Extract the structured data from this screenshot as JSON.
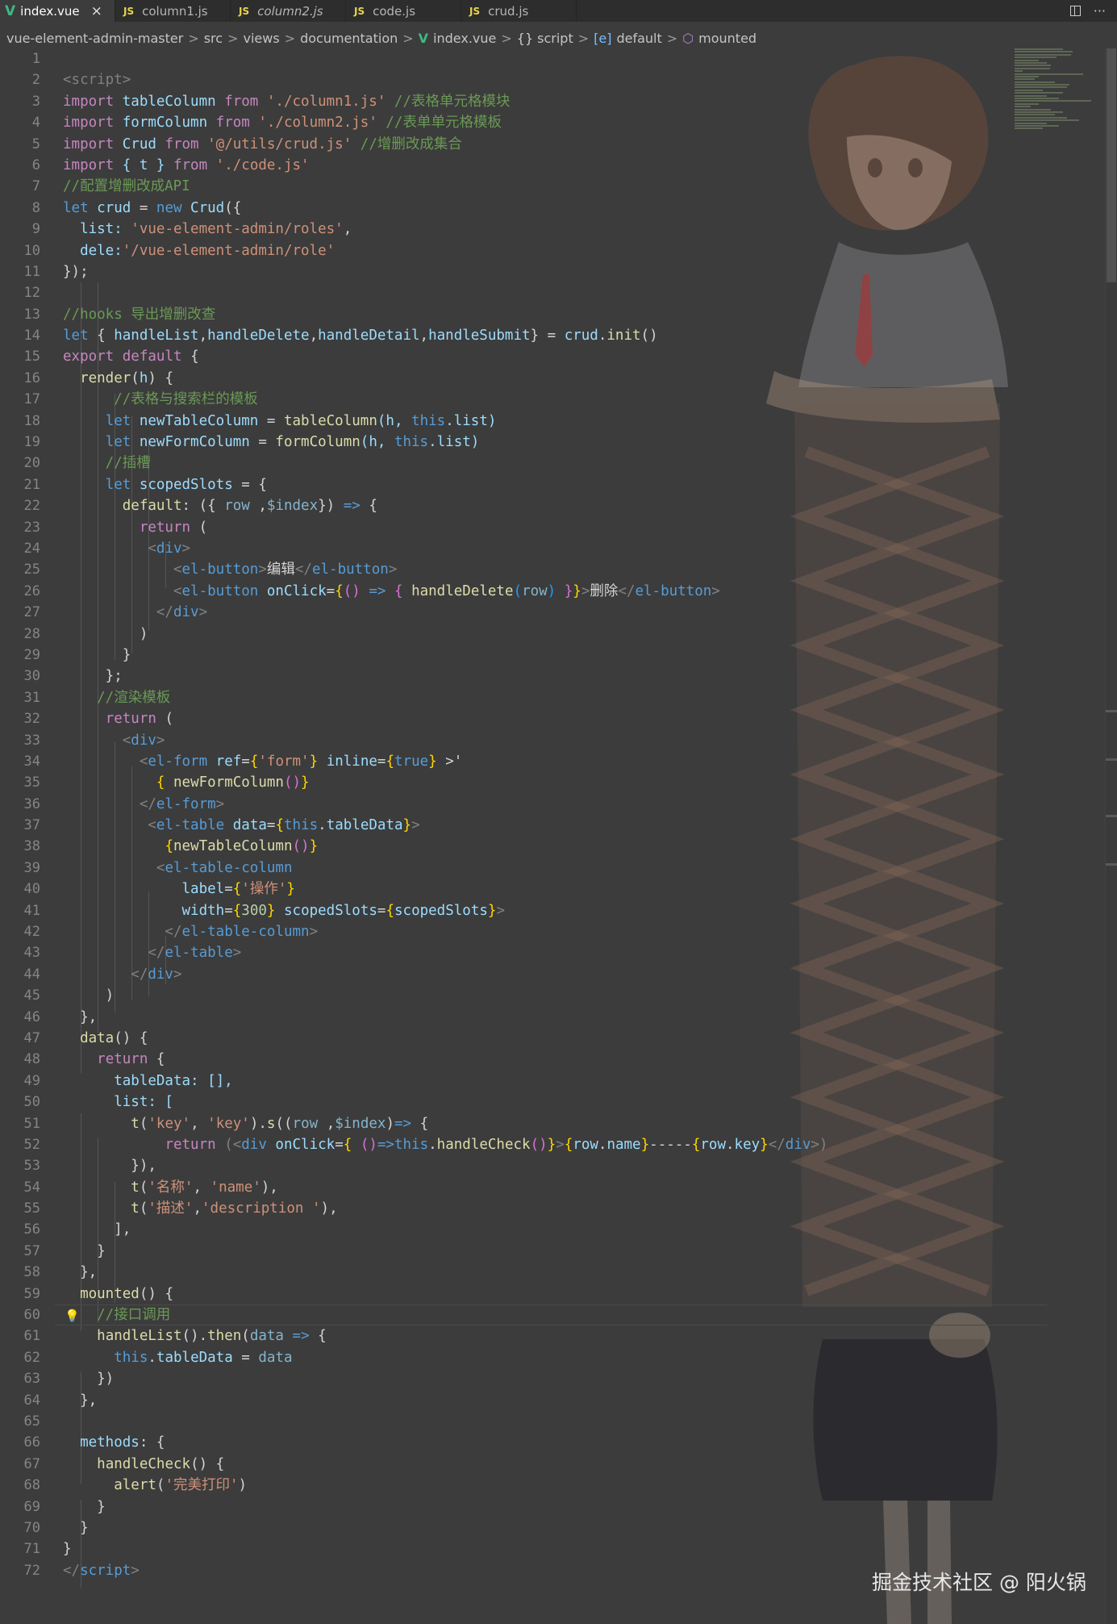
{
  "tabs": [
    {
      "label": "index.vue",
      "icon": "vue-icon",
      "active": true,
      "close": "×"
    },
    {
      "label": "column1.js",
      "icon": "js-icon",
      "icon_text": "JS"
    },
    {
      "label": "column2.js",
      "icon": "js-icon",
      "icon_text": "JS",
      "italic": true
    },
    {
      "label": "code.js",
      "icon": "js-icon",
      "icon_text": "JS"
    },
    {
      "label": "crud.js",
      "icon": "js-icon",
      "icon_text": "JS"
    }
  ],
  "tab_actions": {
    "more": "···"
  },
  "breadcrumb": {
    "items": [
      "vue-element-admin-master",
      "src",
      "views",
      "documentation"
    ],
    "file": "index.vue",
    "file_icon": "V",
    "braces": "{}",
    "script": "script",
    "symbol_icon": "[e]",
    "symbol": "default",
    "method_icon": "⬡",
    "method": "mounted",
    "separator": ">"
  },
  "editor": {
    "line_numbers": [
      "1",
      "2",
      "3",
      "4",
      "5",
      "6",
      "7",
      "8",
      "9",
      "10",
      "11",
      "12",
      "13",
      "14",
      "15",
      "16",
      "17",
      "18",
      "19",
      "20",
      "21",
      "22",
      "23",
      "24",
      "25",
      "26",
      "27",
      "28",
      "29",
      "30",
      "31",
      "32",
      "33",
      "34",
      "35",
      "36",
      "37",
      "38",
      "39",
      "40",
      "41",
      "42",
      "43",
      "44",
      "45",
      "46",
      "47",
      "48",
      "49",
      "50",
      "51",
      "52",
      "53",
      "54",
      "55",
      "56",
      "57",
      "58",
      "59",
      "60",
      "61",
      "62",
      "63",
      "64",
      "65",
      "66",
      "67",
      "68",
      "69",
      "70",
      "71",
      "72"
    ],
    "current_line": 60,
    "lightbulb_line": 60
  },
  "code": {
    "l2": [
      "<script>"
    ],
    "l3": [
      "import",
      " tableColumn ",
      "from",
      " './column1.js'",
      " //表格单元格模块"
    ],
    "l4": [
      "import",
      " formColumn ",
      "from",
      " './column2.js'",
      " //表单单元格模板"
    ],
    "l5": [
      "import",
      " Crud ",
      "from",
      " '@/utils/crud.js'",
      " //增删改成集合"
    ],
    "l6": [
      "import",
      " { t } ",
      "from",
      " './code.js'"
    ],
    "l7": [
      "//配置增删改成API"
    ],
    "l8": [
      "let",
      " crud",
      " = ",
      "new",
      " Crud",
      "({"
    ],
    "l9": [
      "  list: ",
      "'vue-element-admin/roles'",
      ","
    ],
    "l10": [
      "  dele:",
      "'/vue-element-admin/role'"
    ],
    "l11": [
      "});"
    ],
    "l13": [
      "//hooks 导出增删改查"
    ],
    "l14": [
      "let",
      " { ",
      "handleList",
      ",",
      "handleDelete",
      ",",
      "handleDetail",
      ",",
      "handleSubmit",
      "} = ",
      "crud",
      ".",
      "init",
      "()"
    ],
    "l15": [
      "export",
      " ",
      "default",
      " {"
    ],
    "l16": [
      "  ",
      "render",
      "(",
      "h",
      ") {"
    ],
    "l17": [
      "      //表格与搜索栏的模板"
    ],
    "l18": [
      "     ",
      "let",
      " ",
      "newTableColumn",
      " = ",
      "tableColumn",
      "(h, ",
      "this",
      ".list)"
    ],
    "l19": [
      "     ",
      "let",
      " ",
      "newFormColumn",
      " = ",
      "formColumn",
      "(h, ",
      "this",
      ".list)"
    ],
    "l20": [
      "     //插槽"
    ],
    "l21": [
      "     ",
      "let",
      " ",
      "scopedSlots",
      " = {"
    ],
    "l22": [
      "       ",
      "default",
      ": ({ ",
      "row",
      " ,",
      "$index",
      "}) ",
      "=>",
      " {"
    ],
    "l23": [
      "         ",
      "return",
      " ("
    ],
    "l24": [
      "          <",
      "div",
      ">"
    ],
    "l25": [
      "             <",
      "el-button",
      ">",
      "编辑",
      "</",
      "el-button",
      ">"
    ],
    "l26": [
      "             <",
      "el-button",
      " ",
      "onClick",
      "=",
      "{",
      "()",
      " => ",
      "{",
      " ",
      "handleDelete",
      "(",
      "row",
      ") ",
      "}",
      "}",
      ">",
      "删除",
      "</",
      "el-button",
      ">"
    ],
    "l27": [
      "           </",
      "div",
      ">"
    ],
    "l28": [
      "         )"
    ],
    "l29": [
      "       }"
    ],
    "l30": [
      "     };"
    ],
    "l31": [
      "    //渲染模板"
    ],
    "l32": [
      "     ",
      "return",
      " ("
    ],
    "l33": [
      "       <",
      "div",
      ">"
    ],
    "l34": [
      "         <",
      "el-form",
      " ",
      "ref",
      "=",
      "{",
      "'form'",
      "}",
      " ",
      "inline",
      "=",
      "{",
      "true",
      "}",
      " >'"
    ],
    "l35": [
      "           ",
      "{",
      " ",
      "newFormColumn",
      "()",
      "}"
    ],
    "l36": [
      "         </",
      "el-form",
      ">"
    ],
    "l37": [
      "          <",
      "el-table",
      " ",
      "data",
      "=",
      "{",
      "this",
      ".",
      "tableData",
      "}",
      ">"
    ],
    "l38": [
      "            ",
      "{",
      "newTableColumn",
      "()",
      "}"
    ],
    "l39": [
      "           <",
      "el-table-column"
    ],
    "l40": [
      "              ",
      "label",
      "=",
      "{",
      "'操作'",
      "}"
    ],
    "l41": [
      "              ",
      "width",
      "=",
      "{",
      "300",
      "}",
      " ",
      "scopedSlots",
      "=",
      "{",
      "scopedSlots",
      "}",
      ">"
    ],
    "l42": [
      "            </",
      "el-table-column",
      ">"
    ],
    "l43": [
      "          </",
      "el-table",
      ">"
    ],
    "l44": [
      "        </",
      "div",
      ">"
    ],
    "l45": [
      "     )"
    ],
    "l46": [
      "  },"
    ],
    "l47": [
      "  ",
      "data",
      "() {"
    ],
    "l48": [
      "    ",
      "return",
      " {"
    ],
    "l49": [
      "      tableData: [],"
    ],
    "l50": [
      "      list: ["
    ],
    "l51": [
      "        ",
      "t",
      "(",
      "'key'",
      ", ",
      "'key'",
      ").",
      "s",
      "((",
      "row",
      " ,",
      "$index",
      ")",
      "=>",
      " {"
    ],
    "l52": [
      "            ",
      "return",
      " (<",
      "div",
      " ",
      "onClick",
      "=",
      "{",
      " ()",
      "=>",
      "this",
      ".",
      "handleCheck",
      "()",
      "}",
      ">",
      "{",
      "row",
      ".",
      "name",
      "}",
      "-----",
      "{",
      "row",
      ".",
      "key",
      "}",
      "</",
      "div",
      ">)"
    ],
    "l53": [
      "        }),"
    ],
    "l54": [
      "        ",
      "t",
      "(",
      "'名称'",
      ", ",
      "'name'",
      "),"
    ],
    "l55": [
      "        ",
      "t",
      "(",
      "'描述'",
      ",",
      "'description '",
      "),"
    ],
    "l56": [
      "      ],"
    ],
    "l57": [
      "    }"
    ],
    "l58": [
      "  },"
    ],
    "l59": [
      "  ",
      "mounted",
      "() {"
    ],
    "l60": [
      "    //接口调用"
    ],
    "l61": [
      "    ",
      "handleList",
      "().",
      "then",
      "(",
      "data",
      " ",
      "=>",
      " {"
    ],
    "l62": [
      "      ",
      "this",
      ".",
      "tableData",
      " = ",
      "data"
    ],
    "l63": [
      "    })"
    ],
    "l64": [
      "  },"
    ],
    "l66": [
      "  ",
      "methods",
      ": {"
    ],
    "l67": [
      "    ",
      "handleCheck",
      "() {"
    ],
    "l68": [
      "      ",
      "alert",
      "(",
      "'完美打印'",
      ")"
    ],
    "l69": [
      "    }"
    ],
    "l70": [
      "  }"
    ],
    "l71": [
      "}"
    ],
    "l72": [
      "</",
      "script",
      ">"
    ]
  },
  "watermark": "掘金技术社区 @ 阳火锅",
  "colors": {
    "background": "#3c3c3c",
    "keyword": "#569cd6",
    "control": "#c586c0",
    "function": "#dcdcaa",
    "string": "#ce9178",
    "comment": "#6a9955",
    "variable": "#9cdcfe"
  }
}
